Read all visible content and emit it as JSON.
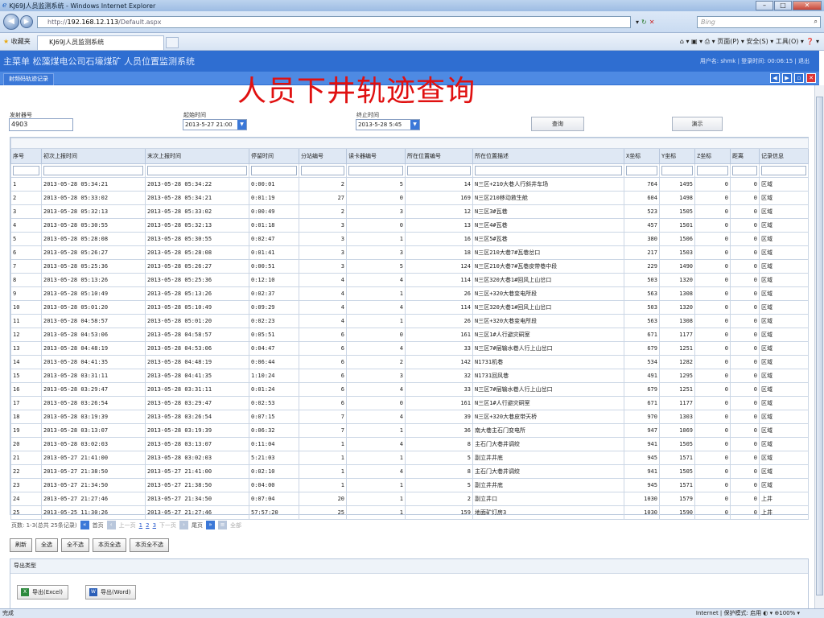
{
  "window": {
    "title": "KJ69J人员监测系统 - Windows Internet Explorer"
  },
  "browser": {
    "address_prefix": "http://",
    "address_host": "192.168.12.113",
    "address_path": "/Default.aspx",
    "search_placeholder": "Bing",
    "favorites_label": "收藏夹",
    "tab_title": "KJ69J人员监测系统",
    "commands": "页面(P) ▾  安全(S) ▾  工具(O) ▾"
  },
  "app": {
    "title": "主菜单 松藻煤电公司石壕煤矿  人员位置监测系统",
    "user_info": "用户名: shmk | 登录时间: 00:06:15 | 退出",
    "tab_label": "射频码轨迹记录",
    "overlay_title": "人员下井轨迹查询"
  },
  "form": {
    "card_label": "发射器号",
    "card_value": "4903",
    "start_label": "起始时间",
    "start_value": "2013-5-27 21:00",
    "end_label": "终止时间",
    "end_value": "2013-5-28 5:45",
    "query_button": "查询",
    "show_button": "演示"
  },
  "table": {
    "columns": [
      "序号",
      "初次上报时间",
      "末次上报时间",
      "停留时间",
      "分站编号",
      "读卡器编号",
      "所在位置编号",
      "所在位置描述",
      "X坐标",
      "Y坐标",
      "Z坐标",
      "距离",
      "记录信息"
    ],
    "rows": [
      [
        "1",
        "2013-05-28 05:34:21",
        "2013-05-28 05:34:22",
        "0:00:01",
        "2",
        "5",
        "14",
        "N三区+210大巷人行斜井车场",
        "764",
        "1495",
        "0",
        "0",
        "区域"
      ],
      [
        "2",
        "2013-05-28 05:33:02",
        "2013-05-28 05:34:21",
        "0:01:19",
        "27",
        "0",
        "169",
        "N三区210移动救生舱",
        "604",
        "1498",
        "0",
        "0",
        "区域"
      ],
      [
        "3",
        "2013-05-28 05:32:13",
        "2013-05-28 05:33:02",
        "0:00:49",
        "2",
        "3",
        "12",
        "N三区3#瓦巷",
        "523",
        "1505",
        "0",
        "0",
        "区域"
      ],
      [
        "4",
        "2013-05-28 05:30:55",
        "2013-05-28 05:32:13",
        "0:01:18",
        "3",
        "0",
        "13",
        "N三区4#瓦巷",
        "457",
        "1501",
        "0",
        "0",
        "区域"
      ],
      [
        "5",
        "2013-05-28 05:28:08",
        "2013-05-28 05:30:55",
        "0:02:47",
        "3",
        "1",
        "16",
        "N三区5#瓦巷",
        "380",
        "1506",
        "0",
        "0",
        "区域"
      ],
      [
        "6",
        "2013-05-28 05:26:27",
        "2013-05-28 05:28:08",
        "0:01:41",
        "3",
        "3",
        "18",
        "N三区210大巷7#瓦巷岔口",
        "217",
        "1503",
        "0",
        "0",
        "区域"
      ],
      [
        "7",
        "2013-05-28 05:25:36",
        "2013-05-28 05:26:27",
        "0:00:51",
        "3",
        "5",
        "124",
        "N三区210大巷7#瓦巷皮带巷中段",
        "229",
        "1490",
        "0",
        "0",
        "区域"
      ],
      [
        "8",
        "2013-05-28 05:13:26",
        "2013-05-28 05:25:36",
        "0:12:10",
        "4",
        "4",
        "114",
        "N三区320大巷1#回风上山岔口",
        "503",
        "1320",
        "0",
        "0",
        "区域"
      ],
      [
        "9",
        "2013-05-28 05:10:49",
        "2013-05-28 05:13:26",
        "0:02:37",
        "4",
        "1",
        "26",
        "N三区+320大巷变电所段",
        "563",
        "1308",
        "0",
        "0",
        "区域"
      ],
      [
        "10",
        "2013-05-28 05:01:20",
        "2013-05-28 05:10:49",
        "0:09:29",
        "4",
        "4",
        "114",
        "N三区320大巷1#回风上山岔口",
        "503",
        "1320",
        "0",
        "0",
        "区域"
      ],
      [
        "11",
        "2013-05-28 04:58:57",
        "2013-05-28 05:01:20",
        "0:02:23",
        "4",
        "1",
        "26",
        "N三区+320大巷变电所段",
        "563",
        "1308",
        "0",
        "0",
        "区域"
      ],
      [
        "12",
        "2013-05-28 04:53:06",
        "2013-05-28 04:58:57",
        "0:05:51",
        "6",
        "0",
        "161",
        "N三区1#人行避灾硐室",
        "671",
        "1177",
        "0",
        "0",
        "区域"
      ],
      [
        "13",
        "2013-05-28 04:48:19",
        "2013-05-28 04:53:06",
        "0:04:47",
        "6",
        "4",
        "33",
        "N三区7#层输水巷人行上山岔口",
        "679",
        "1251",
        "0",
        "0",
        "区域"
      ],
      [
        "14",
        "2013-05-28 04:41:35",
        "2013-05-28 04:48:19",
        "0:06:44",
        "6",
        "2",
        "142",
        "N1731机巷",
        "534",
        "1282",
        "0",
        "0",
        "区域"
      ],
      [
        "15",
        "2013-05-28 03:31:11",
        "2013-05-28 04:41:35",
        "1:10:24",
        "6",
        "3",
        "32",
        "N1731回风巷",
        "491",
        "1295",
        "0",
        "0",
        "区域"
      ],
      [
        "16",
        "2013-05-28 03:29:47",
        "2013-05-28 03:31:11",
        "0:01:24",
        "6",
        "4",
        "33",
        "N三区7#层输水巷人行上山岔口",
        "679",
        "1251",
        "0",
        "0",
        "区域"
      ],
      [
        "17",
        "2013-05-28 03:26:54",
        "2013-05-28 03:29:47",
        "0:02:53",
        "6",
        "0",
        "161",
        "N三区1#人行避灾硐室",
        "671",
        "1177",
        "0",
        "0",
        "区域"
      ],
      [
        "18",
        "2013-05-28 03:19:39",
        "2013-05-28 03:26:54",
        "0:07:15",
        "7",
        "4",
        "39",
        "N三区+320大巷皮带天桥",
        "970",
        "1303",
        "0",
        "0",
        "区域"
      ],
      [
        "19",
        "2013-05-28 03:13:07",
        "2013-05-28 03:19:39",
        "0:06:32",
        "7",
        "1",
        "36",
        "南大巷主石门变电所",
        "947",
        "1069",
        "0",
        "0",
        "区域"
      ],
      [
        "20",
        "2013-05-28 03:02:03",
        "2013-05-28 03:13:07",
        "0:11:04",
        "1",
        "4",
        "8",
        "主石门大巷井调绞",
        "941",
        "1505",
        "0",
        "0",
        "区域"
      ],
      [
        "21",
        "2013-05-27 21:41:00",
        "2013-05-28 03:02:03",
        "5:21:03",
        "1",
        "1",
        "5",
        "副立井井底",
        "945",
        "1571",
        "0",
        "0",
        "区域"
      ],
      [
        "22",
        "2013-05-27 21:38:50",
        "2013-05-27 21:41:00",
        "0:02:10",
        "1",
        "4",
        "8",
        "主石门大巷井调绞",
        "941",
        "1505",
        "0",
        "0",
        "区域"
      ],
      [
        "23",
        "2013-05-27 21:34:50",
        "2013-05-27 21:38:50",
        "0:04:00",
        "1",
        "1",
        "5",
        "副立井井底",
        "945",
        "1571",
        "0",
        "0",
        "区域"
      ],
      [
        "24",
        "2013-05-27 21:27:46",
        "2013-05-27 21:34:50",
        "0:07:04",
        "20",
        "1",
        "2",
        "副立井口",
        "1030",
        "1579",
        "0",
        "0",
        "上井"
      ],
      [
        "25",
        "2013-05-25 11:30:26",
        "2013-05-27 21:27:46",
        "57:57:20",
        "25",
        "1",
        "159",
        "地面矿灯房3",
        "1030",
        "1590",
        "0",
        "0",
        "上井"
      ]
    ]
  },
  "pager": {
    "summary": "页数: 1-3(总共 25条记录)",
    "first": "首页",
    "prev": "上一页",
    "pages": [
      "1",
      "2",
      "3"
    ],
    "next": "下一页",
    "last": "尾页",
    "all": "全部"
  },
  "actions": [
    "刷新",
    "全选",
    "全不选",
    "本页全选",
    "本页全不选"
  ],
  "export": {
    "header": "导出类型",
    "excel": "导出(Excel)",
    "word": "导出(Word)"
  },
  "status": {
    "left": "完成",
    "right": "Internet | 保护模式: 启用     ◐ ▾  ⊕100%  ▾"
  }
}
